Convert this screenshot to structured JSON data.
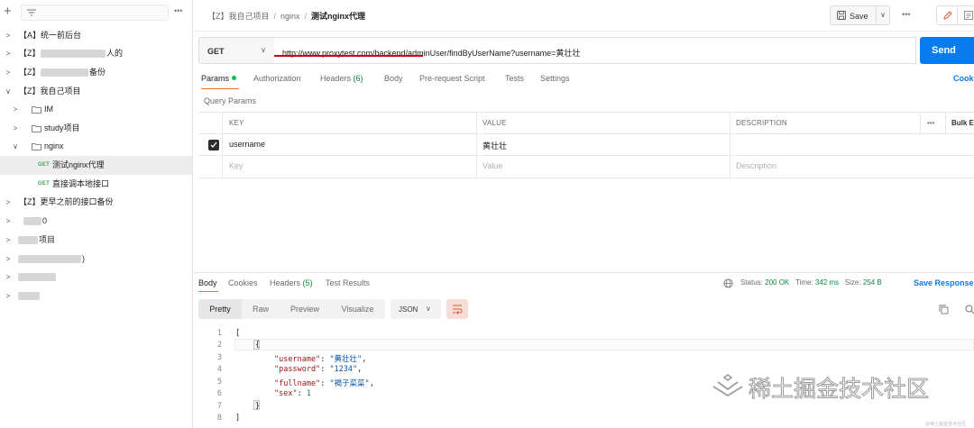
{
  "sidebar": {
    "items": [
      {
        "label": "【A】统一前后台"
      },
      {
        "label": "【Z】",
        "suffix": "人的"
      },
      {
        "label": "【Z】",
        "suffix": "备份"
      },
      {
        "label": "【Z】我自己项目"
      },
      {
        "label": "IM"
      },
      {
        "label": "study项目"
      },
      {
        "label": "nginx"
      },
      {
        "method": "GET",
        "label": "测试nginx代理"
      },
      {
        "method": "GET",
        "label": "直接调本地接口"
      },
      {
        "label": "【Z】更早之前的接口备份"
      },
      {
        "label": "0"
      },
      {
        "label": "项目"
      },
      {
        "label": ")"
      },
      {
        "label": ""
      },
      {
        "label": ""
      }
    ]
  },
  "header": {
    "breadcrumb": [
      "【Z】我自己项目",
      "nginx",
      "测试nginx代理"
    ],
    "separator": "/",
    "save_label": "Save",
    "more_label": "•••"
  },
  "request": {
    "method": "GET",
    "url": "http://www.proxytest.com/backend/adminUser/findByUserName?username=黄壮壮",
    "send_label": "Send"
  },
  "request_tabs": [
    {
      "label": "Params",
      "dot": true
    },
    {
      "label": "Authorization"
    },
    {
      "label": "Headers",
      "count": "(6)"
    },
    {
      "label": "Body"
    },
    {
      "label": "Pre-request Script"
    },
    {
      "label": "Tests"
    },
    {
      "label": "Settings"
    }
  ],
  "cookies_label": "Cooki",
  "query_params_title": "Query Params",
  "params_table": {
    "headers": [
      "KEY",
      "VALUE",
      "DESCRIPTION"
    ],
    "more_label": "•••",
    "bulk_edit_label": "Bulk E",
    "rows": [
      {
        "key": "username",
        "value": "黄壮壮",
        "description": "",
        "checked": true
      }
    ],
    "placeholders": {
      "key": "Key",
      "value": "Value",
      "description": "Description"
    }
  },
  "response_tabs": [
    {
      "label": "Body"
    },
    {
      "label": "Cookies"
    },
    {
      "label": "Headers",
      "count": "(5)"
    },
    {
      "label": "Test Results"
    }
  ],
  "response_meta": {
    "status_label": "Status:",
    "status_value": "200 OK",
    "time_label": "Time:",
    "time_value": "342 ms",
    "size_label": "Size:",
    "size_value": "254 B",
    "save_response_label": "Save Response"
  },
  "view_modes": [
    "Pretty",
    "Raw",
    "Preview",
    "Visualize"
  ],
  "format": "JSON",
  "code_lines": [
    {
      "n": "1",
      "text": "["
    },
    {
      "n": "2",
      "text": "{"
    },
    {
      "n": "3",
      "key": "\"username\"",
      "value": "\"黄壮壮\"",
      "trail": ","
    },
    {
      "n": "4",
      "key": "\"password\"",
      "value": "\"1234\"",
      "trail": ","
    },
    {
      "n": "5",
      "key": "\"fullname\"",
      "value": "\"褐子菜菜\"",
      "trail": ","
    },
    {
      "n": "6",
      "key": "\"sex\"",
      "num": "1",
      "trail": ""
    },
    {
      "n": "7",
      "text": "}"
    },
    {
      "n": "8",
      "text": "]"
    }
  ],
  "watermark": {
    "text": "稀土掘金技术社区",
    "small": "@稀土掘金技术社区"
  },
  "colors": {
    "send": "#097bed",
    "accent_underline": "#f26b3a",
    "status_ok": "#0a8a3f",
    "url_annotation": "#d0021b"
  }
}
